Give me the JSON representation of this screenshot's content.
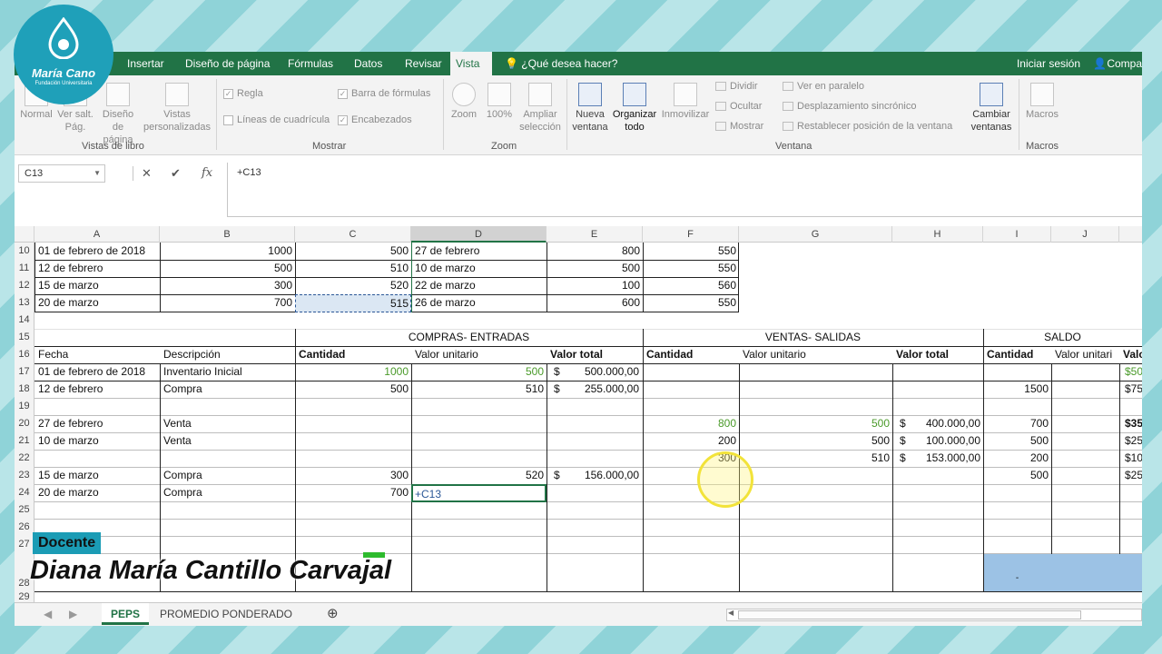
{
  "logo": {
    "name": "María Cano",
    "sub": "Fundación Universitaria"
  },
  "tabs": [
    "Insertar",
    "Diseño de página",
    "Fórmulas",
    "Datos",
    "Revisar",
    "Vista"
  ],
  "tell_me": "¿Qué desea hacer?",
  "signin": "Iniciar sesión",
  "share": "Compa",
  "ribbon": {
    "normal": "Normal",
    "page_break": "Ver salt. Pág.",
    "page_layout": "Diseño de página",
    "custom_views": "Vistas personalizadas",
    "group_views": "Vistas de libro",
    "ruler": "Regla",
    "formula_bar": "Barra de fórmulas",
    "gridlines": "Líneas de cuadrícula",
    "headings": "Encabezados",
    "group_show": "Mostrar",
    "zoom": "Zoom",
    "zoom100": "100%",
    "zoom_sel": "Ampliar selección",
    "group_zoom": "Zoom",
    "new_window": "Nueva ventana",
    "arrange": "Organizar todo",
    "freeze": "Inmovilizar",
    "split": "Dividir",
    "hide": "Ocultar",
    "unhide": "Mostrar",
    "side_by_side": "Ver en paralelo",
    "sync_scroll": "Desplazamiento sincrónico",
    "reset_pos": "Restablecer posición de la ventana",
    "switch": "Cambiar ventanas",
    "group_window": "Ventana",
    "macros": "Macros",
    "group_macros": "Macros"
  },
  "formula": {
    "namebox": "C13",
    "content": "+C13"
  },
  "columns": [
    "A",
    "B",
    "C",
    "D",
    "E",
    "F",
    "G",
    "H",
    "I",
    "J"
  ],
  "rows": [
    "10",
    "11",
    "12",
    "13",
    "14",
    "15",
    "16",
    "17",
    "18",
    "19",
    "20",
    "21",
    "22",
    "23",
    "24",
    "25",
    "26",
    "27",
    "28",
    "29"
  ],
  "top_table": [
    [
      "01 de febrero de 2018",
      "1000",
      "500",
      "27 de febrero",
      "800",
      "550"
    ],
    [
      "12 de febrero",
      "500",
      "510",
      "10 de marzo",
      "500",
      "550"
    ],
    [
      "15 de marzo",
      "300",
      "520",
      "22 de marzo",
      "100",
      "560"
    ],
    [
      "20 de marzo",
      "700",
      "515",
      "26 de marzo",
      "600",
      "550"
    ]
  ],
  "sections": {
    "compras": "COMPRAS- ENTRADAS",
    "ventas": "VENTAS- SALIDAS",
    "saldo": "SALDO"
  },
  "headers": [
    "Fecha",
    "Descripción",
    "Cantidad",
    "Valor unitario",
    "Valor total",
    "Cantidad",
    "Valor unitario",
    "Valor total",
    "Cantidad",
    "Valor unitari",
    "Valo"
  ],
  "kardex": {
    "r17": {
      "a": "01 de febrero de 2018",
      "b": "Inventario Inicial",
      "c": "1000",
      "d": "500",
      "e_sym": "$",
      "e": "500.000,00",
      "j": "$50"
    },
    "r18": {
      "a": "12 de febrero",
      "b": "Compra",
      "c": "500",
      "d": "510",
      "e_sym": "$",
      "e": "255.000,00",
      "i": "1500",
      "j": "$75"
    },
    "r20": {
      "a": "27 de febrero",
      "b": "Venta",
      "f": "800",
      "g": "500",
      "h_sym": "$",
      "h": "400.000,00",
      "i": "700",
      "j": "$35"
    },
    "r21": {
      "a": "10 de marzo",
      "b": "Venta",
      "f": "200",
      "g": "500",
      "h_sym": "$",
      "h": "100.000,00",
      "i": "500",
      "j": "$25"
    },
    "r22": {
      "f": "300",
      "g": "510",
      "h_sym": "$",
      "h": "153.000,00",
      "i": "200",
      "j": "$10"
    },
    "r23": {
      "a": "15 de marzo",
      "b": "Compra",
      "c": "300",
      "d": "520",
      "e_sym": "$",
      "e": "156.000,00",
      "i": "500",
      "j": "$25"
    },
    "r24": {
      "a": "20 de marzo",
      "b": "Compra",
      "c": "700",
      "d": "+C13"
    },
    "r28": {
      "i": "-"
    }
  },
  "sheets": [
    "PEPS",
    "PROMEDIO PONDERADO"
  ],
  "overlay": {
    "role": "Docente",
    "name": "Diana María Cantillo Carvajal"
  },
  "colors": {
    "excel_green": "#217346",
    "highlight_blue": "#9cc2e5",
    "accent": "#1fa0b9"
  }
}
